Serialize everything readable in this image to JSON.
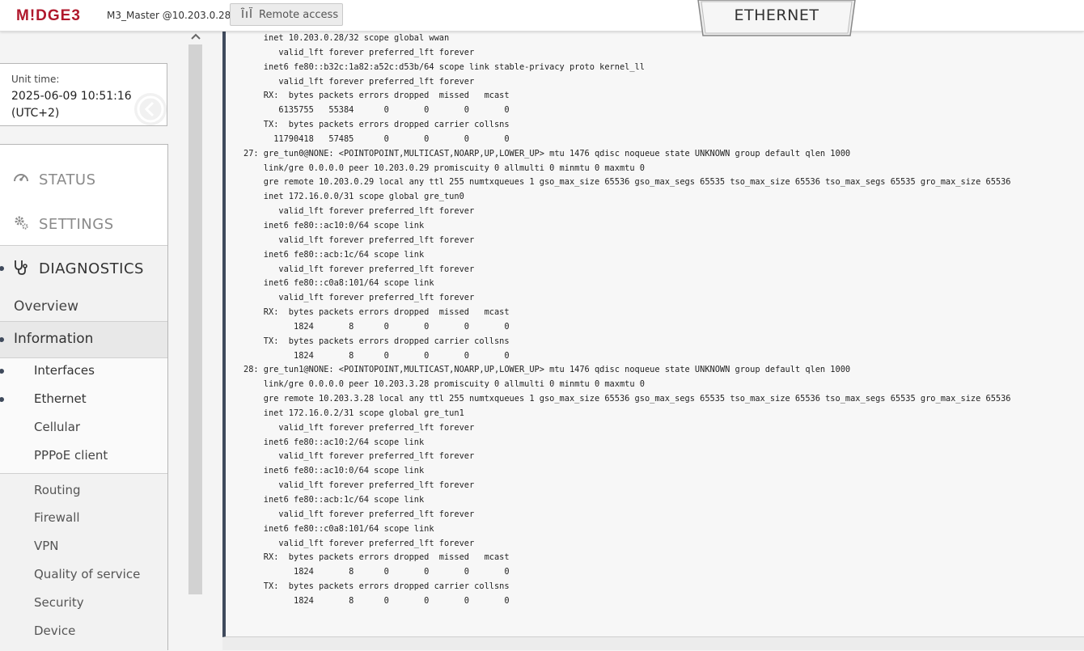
{
  "header": {
    "logo": "M!DGE3",
    "device_name": "M3_Master @10.203.0.28",
    "remote_access_label": "Remote access",
    "active_tab": "ETHERNET"
  },
  "unit": {
    "label": "Unit time:",
    "time": "2025-06-09 10:51:16 (UTC+2)"
  },
  "menu": {
    "status": "STATUS",
    "settings": "SETTINGS",
    "diagnostics": "DIAGNOSTICS",
    "overview": "Overview",
    "information": "Information",
    "info_items": [
      "Interfaces",
      "Ethernet",
      "Cellular",
      "PPPoE client"
    ],
    "other_items": [
      "Routing",
      "Firewall",
      "VPN",
      "Quality of service",
      "Security",
      "Device"
    ]
  },
  "console": {
    "lines": [
      "    inet 10.203.0.28/32 scope global wwan",
      "       valid_lft forever preferred_lft forever",
      "    inet6 fe80::b32c:1a82:a52c:d53b/64 scope link stable-privacy proto kernel_ll",
      "       valid_lft forever preferred_lft forever",
      "    RX:  bytes packets errors dropped  missed   mcast",
      "       6135755   55384      0       0       0       0",
      "    TX:  bytes packets errors dropped carrier collsns",
      "      11790418   57485      0       0       0       0",
      "27: gre_tun0@NONE: <POINTOPOINT,MULTICAST,NOARP,UP,LOWER_UP> mtu 1476 qdisc noqueue state UNKNOWN group default qlen 1000",
      "    link/gre 0.0.0.0 peer 10.203.0.29 promiscuity 0 allmulti 0 minmtu 0 maxmtu 0",
      "    gre remote 10.203.0.29 local any ttl 255 numtxqueues 1 gso_max_size 65536 gso_max_segs 65535 tso_max_size 65536 tso_max_segs 65535 gro_max_size 65536",
      "    inet 172.16.0.0/31 scope global gre_tun0",
      "       valid_lft forever preferred_lft forever",
      "    inet6 fe80::ac10:0/64 scope link",
      "       valid_lft forever preferred_lft forever",
      "    inet6 fe80::acb:1c/64 scope link",
      "       valid_lft forever preferred_lft forever",
      "    inet6 fe80::c0a8:101/64 scope link",
      "       valid_lft forever preferred_lft forever",
      "    RX:  bytes packets errors dropped  missed   mcast",
      "          1824       8      0       0       0       0",
      "    TX:  bytes packets errors dropped carrier collsns",
      "          1824       8      0       0       0       0",
      "28: gre_tun1@NONE: <POINTOPOINT,MULTICAST,NOARP,UP,LOWER_UP> mtu 1476 qdisc noqueue state UNKNOWN group default qlen 1000",
      "    link/gre 0.0.0.0 peer 10.203.3.28 promiscuity 0 allmulti 0 minmtu 0 maxmtu 0",
      "    gre remote 10.203.3.28 local any ttl 255 numtxqueues 1 gso_max_size 65536 gso_max_segs 65535 tso_max_size 65536 tso_max_segs 65535 gro_max_size 65536",
      "    inet 172.16.0.2/31 scope global gre_tun1",
      "       valid_lft forever preferred_lft forever",
      "    inet6 fe80::ac10:2/64 scope link",
      "       valid_lft forever preferred_lft forever",
      "    inet6 fe80::ac10:0/64 scope link",
      "       valid_lft forever preferred_lft forever",
      "    inet6 fe80::acb:1c/64 scope link",
      "       valid_lft forever preferred_lft forever",
      "    inet6 fe80::c0a8:101/64 scope link",
      "       valid_lft forever preferred_lft forever",
      "    RX:  bytes packets errors dropped  missed   mcast",
      "          1824       8      0       0       0       0",
      "    TX:  bytes packets errors dropped carrier collsns",
      "          1824       8      0       0       0       0"
    ]
  },
  "icons": {
    "remote": "remote-access-icon",
    "status": "gauge-icon",
    "settings": "gears-icon",
    "diagnostics": "stethoscope-icon",
    "collapse": "chevron-left-icon",
    "scroll_up": "chevron-up-icon"
  },
  "colors": {
    "brand": "#b0182c",
    "accent": "#3f4a5c"
  }
}
